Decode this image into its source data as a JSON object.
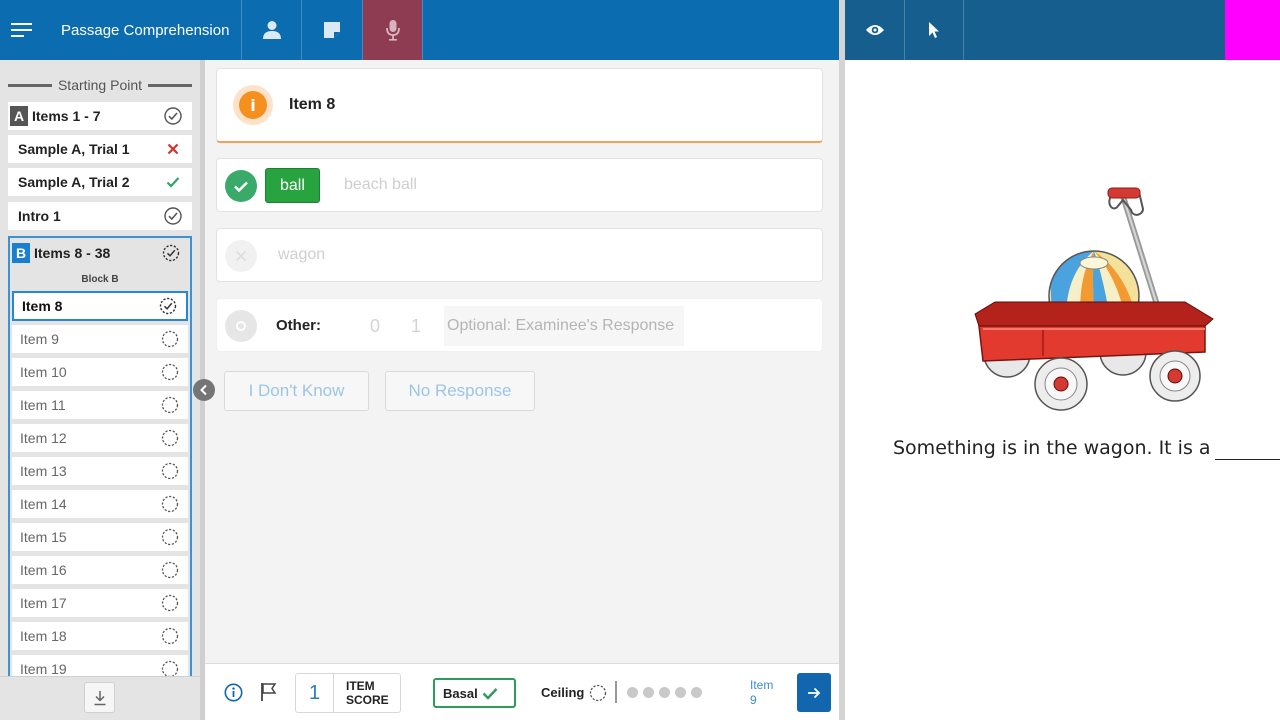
{
  "header": {
    "title": "Passage Comprehension",
    "menu_icon": "hamburger-menu-icon",
    "tools": [
      {
        "name": "examinee-icon"
      },
      {
        "name": "notes-icon"
      },
      {
        "name": "microphone-icon",
        "active": true
      }
    ],
    "right_tools": [
      {
        "name": "eye-icon"
      },
      {
        "name": "pointer-icon"
      }
    ],
    "colors": {
      "bar": "#0c6cb0",
      "bar_right": "#155e8e",
      "mic_active": "#8e3c52",
      "corner": "#ff00ff"
    }
  },
  "sidebar": {
    "starting_point_label": "Starting Point",
    "block_a": {
      "badge": "A",
      "label": "Items 1 - 7",
      "status": "complete"
    },
    "rows": [
      {
        "label": "Sample A, Trial 1",
        "status": "incorrect"
      },
      {
        "label": "Sample A, Trial 2",
        "status": "correct"
      },
      {
        "label": "Intro 1",
        "status": "complete"
      }
    ],
    "block_b": {
      "badge": "B",
      "label": "Items 8 - 38",
      "sub_label": "Block B",
      "status": "in-progress",
      "items": [
        {
          "label": "Item 8",
          "current": true
        },
        {
          "label": "Item 9"
        },
        {
          "label": "Item 10"
        },
        {
          "label": "Item 11"
        },
        {
          "label": "Item 12"
        },
        {
          "label": "Item 13"
        },
        {
          "label": "Item 14"
        },
        {
          "label": "Item 15"
        },
        {
          "label": "Item 16"
        },
        {
          "label": "Item 17"
        },
        {
          "label": "Item 18"
        },
        {
          "label": "Item 19"
        }
      ]
    }
  },
  "item": {
    "title": "Item 8",
    "answers": {
      "correct_chip": "ball",
      "correct_alt": "beach ball",
      "incorrect": "wagon"
    },
    "other": {
      "label": "Other:",
      "score_zero": "0",
      "score_one": "1",
      "placeholder": "Optional: Examinee's Response"
    },
    "buttons": {
      "dont_know": "I Don't Know",
      "no_response": "No Response"
    }
  },
  "bottombar": {
    "item_score": "1",
    "item_score_label_1": "ITEM",
    "item_score_label_2": "SCORE",
    "basal_label": "Basal",
    "ceiling_label": "Ceiling",
    "progress_dots": 5,
    "next_label_1": "Item",
    "next_label_2": "9"
  },
  "stimulus": {
    "sentence": "Something is in the wagon. It is a"
  }
}
